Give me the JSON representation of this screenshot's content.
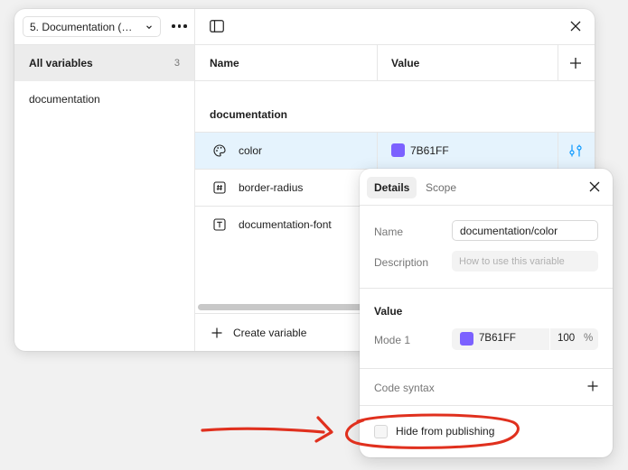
{
  "sidebar": {
    "collection_label": "5. Documentation (D...",
    "all_variables_label": "All variables",
    "all_variables_count": "3",
    "groups": [
      {
        "label": "documentation"
      }
    ]
  },
  "table": {
    "headers": {
      "name": "Name",
      "value": "Value"
    },
    "group_heading": "documentation",
    "rows": [
      {
        "name": "color",
        "value": "7B61FF",
        "swatch": "#7B61FF",
        "icon": "palette-icon"
      },
      {
        "name": "border-radius",
        "icon": "number-icon"
      },
      {
        "name": "documentation-font",
        "icon": "text-icon"
      }
    ],
    "create_label": "Create variable"
  },
  "details": {
    "tabs": [
      {
        "label": "Details"
      },
      {
        "label": "Scope"
      }
    ],
    "name_label": "Name",
    "name_value": "documentation/color",
    "description_label": "Description",
    "description_placeholder": "How to use this variable",
    "value_heading": "Value",
    "mode_label": "Mode 1",
    "mode_hex": "7B61FF",
    "mode_opacity": "100",
    "mode_opacity_unit": "%",
    "mode_swatch": "#7B61FF",
    "code_syntax_label": "Code syntax",
    "hide_label": "Hide from publishing"
  },
  "colors": {
    "accent": "#0D99FF",
    "selection": "#E5F3FD",
    "annotation": "#E0301E"
  }
}
